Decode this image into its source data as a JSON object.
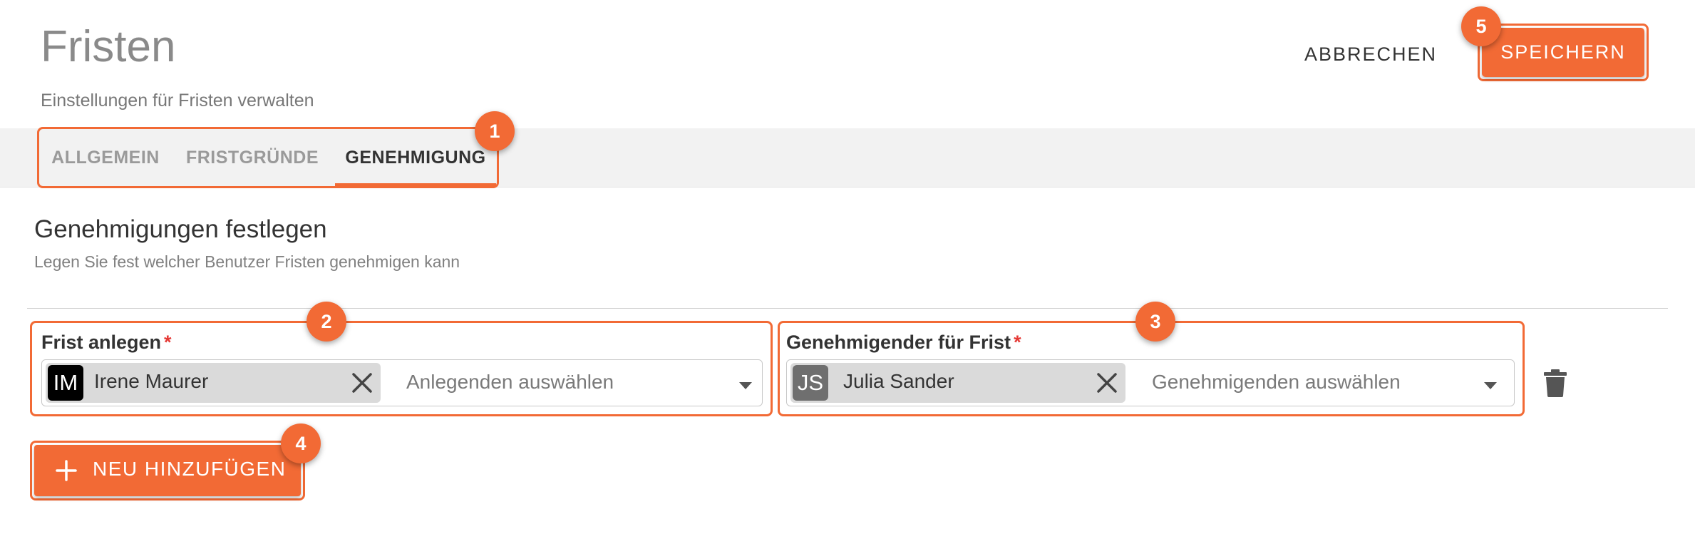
{
  "header": {
    "title": "Fristen",
    "subtitle": "Einstellungen für Fristen verwalten",
    "cancel_label": "ABBRECHEN",
    "save_label": "SPEICHERN"
  },
  "tabs": [
    {
      "label": "ALLGEMEIN",
      "active": false
    },
    {
      "label": "FRISTGRÜNDE",
      "active": false
    },
    {
      "label": "GENEHMIGUNG",
      "active": true
    }
  ],
  "section": {
    "title": "Genehmigungen festlegen",
    "subtitle": "Legen Sie fest welcher Benutzer Fristen genehmigen kann"
  },
  "fields": {
    "creator": {
      "label": "Frist anlegen",
      "required_marker": "*",
      "selected": {
        "initials": "IM",
        "name": "Irene Maurer",
        "avatar_color": "#000000"
      },
      "placeholder": "Anlegenden auswählen"
    },
    "approver": {
      "label": "Genehmigender für Frist",
      "required_marker": "*",
      "selected": {
        "initials": "JS",
        "name": "Julia Sander",
        "avatar_color": "#6f6f6f"
      },
      "placeholder": "Genehmigenden auswählen"
    }
  },
  "add_button_label": "NEU HINZUFÜGEN",
  "badges": [
    "1",
    "2",
    "3",
    "4",
    "5"
  ],
  "icons": {
    "remove_chip": "close-icon",
    "dropdown": "caret-down-icon",
    "delete": "trash-icon",
    "add": "plus-icon"
  },
  "colors": {
    "accent": "#f26a35",
    "required": "#e53935",
    "tabbar_bg": "#f2f2f2"
  }
}
